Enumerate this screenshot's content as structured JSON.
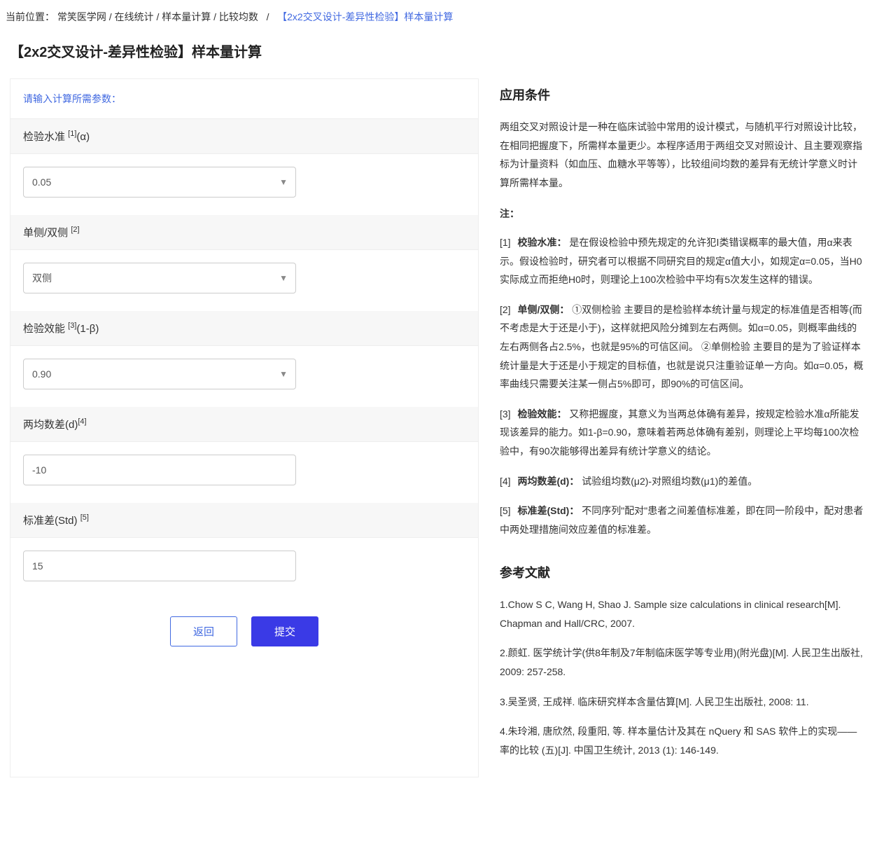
{
  "breadcrumb": {
    "prefix": "当前位置：",
    "path": "常笑医学网 / 在线统计 / 样本量计算 / 比较均数",
    "sep": "/",
    "current": "【2x2交叉设计-差异性检验】样本量计算"
  },
  "page_title": "【2x2交叉设计-差异性检验】样本量计算",
  "form": {
    "prompt": "请输入计算所需参数：",
    "fields": {
      "alpha": {
        "label_pre": "检验水准 ",
        "sup": "[1]",
        "label_post": "(α)",
        "value": "0.05"
      },
      "side": {
        "label_pre": "单侧/双侧 ",
        "sup": "[2]",
        "label_post": "",
        "value": "双侧"
      },
      "power": {
        "label_pre": "检验效能 ",
        "sup": "[3]",
        "label_post": "(1-β)",
        "value": "0.90"
      },
      "meandiff": {
        "label_pre": "两均数差(d)",
        "sup": "[4]",
        "label_post": "",
        "value": "-10"
      },
      "std": {
        "label_pre": "标准差(Std) ",
        "sup": "[5]",
        "label_post": "",
        "value": "15"
      }
    },
    "buttons": {
      "back": "返回",
      "submit": "提交"
    }
  },
  "sidebar": {
    "heading_conditions": "应用条件",
    "conditions_text": "两组交叉对照设计是一种在临床试验中常用的设计模式，与随机平行对照设计比较，在相同把握度下，所需样本量更少。本程序适用于两组交叉对照设计、且主要观察指标为计量资料（如血压、血糖水平等等），比较组间均数的差异有无统计学意义时计算所需样本量。",
    "note_label": "注：",
    "notes": [
      {
        "idx": "[1]",
        "term": "校验水准：",
        "body": "是在假设检验中预先规定的允许犯Ⅰ类错误概率的最大值，用α来表示。假设检验时，研究者可以根据不同研究目的规定α值大小，如规定α=0.05，当H0实际成立而拒绝H0时，则理论上100次检验中平均有5次发生这样的错误。"
      },
      {
        "idx": "[2]",
        "term": "单侧/双侧：",
        "body": "①双侧检验 主要目的是检验样本统计量与规定的标准值是否相等(而不考虑是大于还是小于)，这样就把风险分摊到左右两侧。如α=0.05，则概率曲线的左右两侧各占2.5%，也就是95%的可信区间。 ②单侧检验 主要目的是为了验证样本统计量是大于还是小于规定的目标值，也就是说只注重验证单一方向。如α=0.05，概率曲线只需要关注某一侧占5%即可，即90%的可信区间。"
      },
      {
        "idx": "[3]",
        "term": "检验效能：",
        "body": "又称把握度，其意义为当两总体确有差异，按规定检验水准α所能发现该差异的能力。如1-β=0.90，意味着若两总体确有差别，则理论上平均每100次检验中，有90次能够得出差异有统计学意义的结论。"
      },
      {
        "idx": "[4]",
        "term": "两均数差(d)：",
        "body": "试验组均数(μ2)-对照组均数(μ1)的差值。"
      },
      {
        "idx": "[5]",
        "term": "标准差(Std)：",
        "body": "不同序列\"配对\"患者之间差值标准差，即在同一阶段中，配对患者中两处理措施间效应差值的标准差。"
      }
    ],
    "heading_refs": "参考文献",
    "refs": [
      "1.Chow S C, Wang H, Shao J. Sample size calculations in clinical research[M]. Chapman and Hall/CRC, 2007.",
      "2.颜虹. 医学统计学(供8年制及7年制临床医学等专业用)(附光盘)[M]. 人民卫生出版社, 2009: 257-258.",
      "3.吴圣贤, 王成祥. 临床研究样本含量估算[M]. 人民卫生出版社, 2008: 11.",
      "4.朱玲湘, 唐欣然, 段重阳, 等. 样本量估计及其在 nQuery 和 SAS 软件上的实现——率的比较 (五)[J]. 中国卫生统计, 2013 (1): 146-149."
    ]
  }
}
